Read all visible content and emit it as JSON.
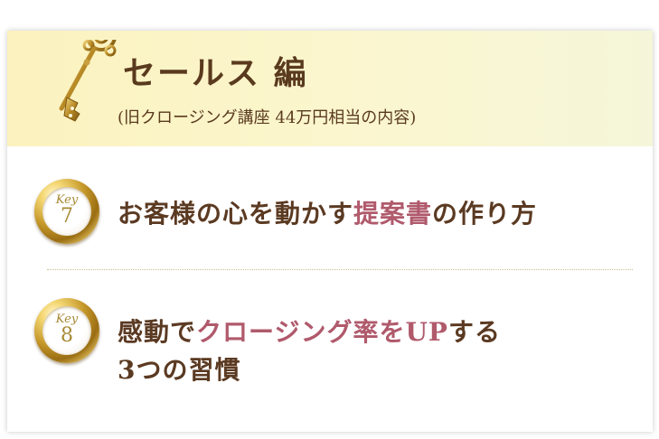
{
  "header": {
    "title": "セールス 編",
    "subtitle": "(旧クロージング講座 44万円相当の内容)"
  },
  "items": [
    {
      "badge_label": "Key",
      "badge_number": "7",
      "text_pre": "お客様の心を動かす",
      "text_highlight": "提案書",
      "text_post": "の作り方"
    },
    {
      "badge_label": "Key",
      "badge_number": "8",
      "text_pre": "感動で",
      "text_highlight": "クロージング率をUP",
      "text_post": "する",
      "text_line2": "3つの習慣"
    }
  ],
  "colors": {
    "heading_brown": "#5a3a1e",
    "highlight_rose": "#b05a6c",
    "gold": "#a88935",
    "header_bg": "#fbf3c4"
  }
}
